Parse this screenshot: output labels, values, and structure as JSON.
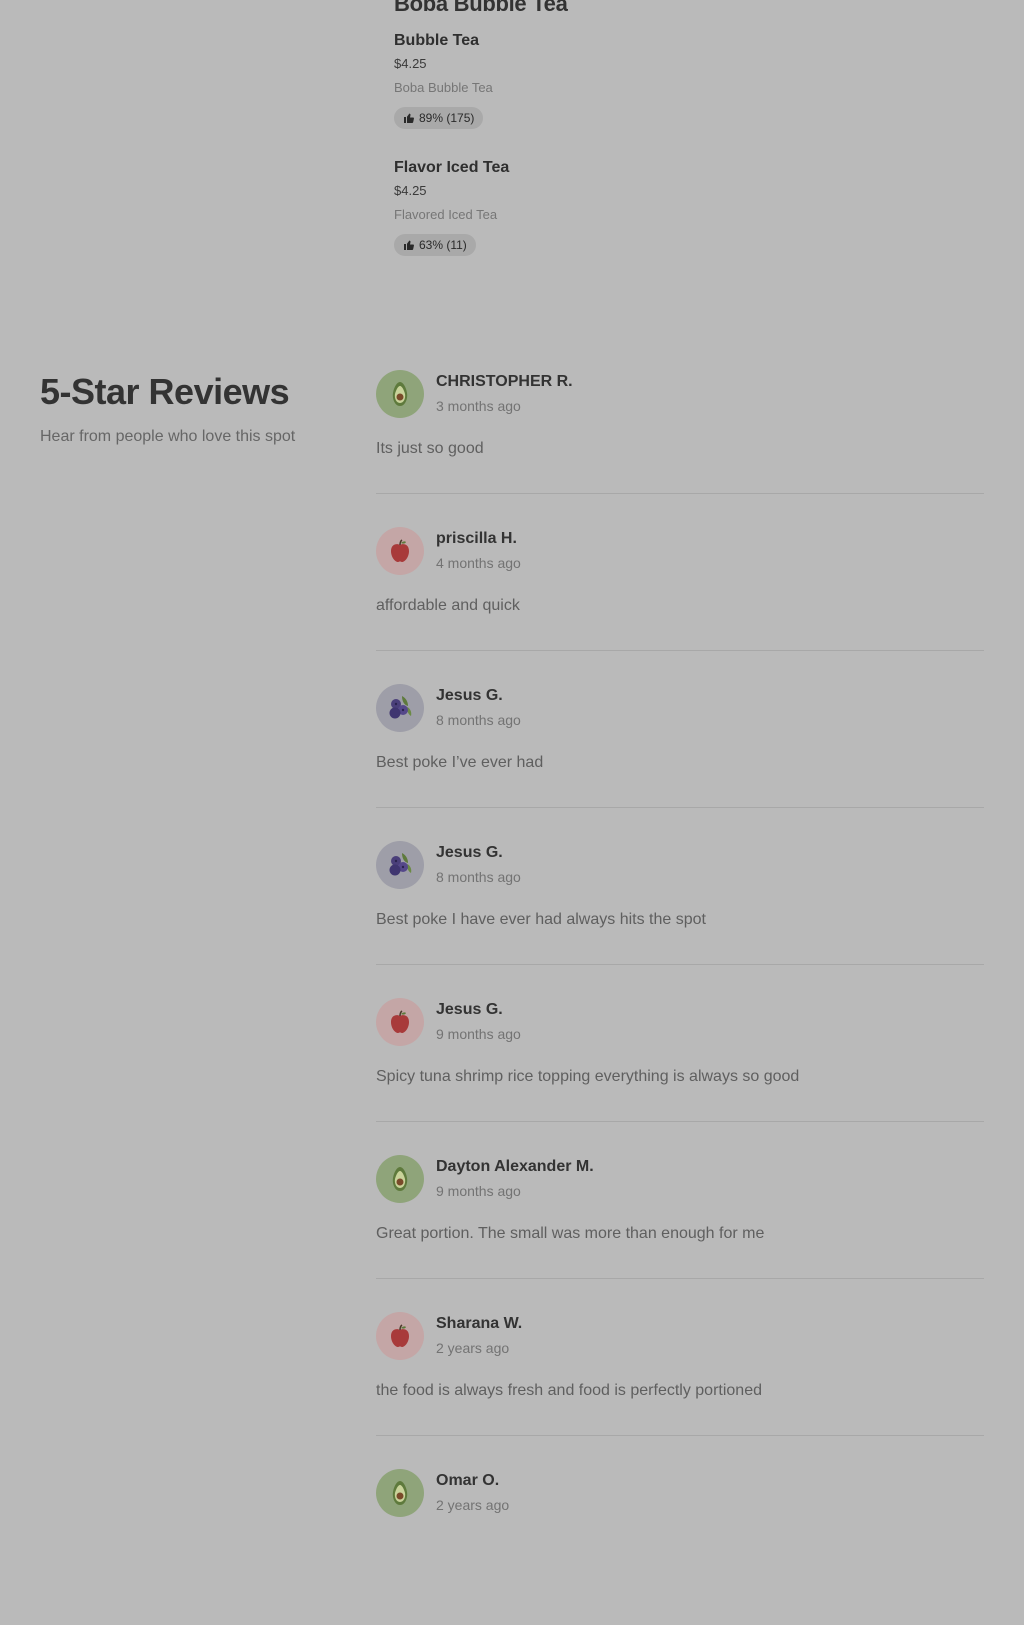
{
  "menu": {
    "section_title": "Boba Bubble Tea",
    "items": [
      {
        "name": "Bubble Tea",
        "price": "$4.25",
        "description": "Boba Bubble Tea",
        "rating": "89% (175)"
      },
      {
        "name": "Flavor Iced Tea",
        "price": "$4.25",
        "description": "Flavored Iced Tea",
        "rating": "63% (11)"
      }
    ]
  },
  "reviews": {
    "title": "5-Star Reviews",
    "subtitle": "Hear from people who love this spot",
    "items": [
      {
        "name": "CHRISTOPHER R.",
        "time": "3 months ago",
        "text": "Its just so good",
        "avatar": "avocado-icon"
      },
      {
        "name": "priscilla H.",
        "time": "4 months ago",
        "text": "affordable and quick",
        "avatar": "apple-icon"
      },
      {
        "name": "Jesus G.",
        "time": "8 months ago",
        "text": "Best poke I’ve ever had",
        "avatar": "blueberries-icon"
      },
      {
        "name": "Jesus G.",
        "time": "8 months ago",
        "text": "Best poke I have ever had always hits the spot",
        "avatar": "blueberries-icon"
      },
      {
        "name": "Jesus G.",
        "time": "9 months ago",
        "text": "Spicy tuna shrimp rice topping everything is always so good",
        "avatar": "apple-icon"
      },
      {
        "name": "Dayton Alexander M.",
        "time": "9 months ago",
        "text": "Great portion. The small was more than enough for me",
        "avatar": "avocado-icon"
      },
      {
        "name": "Sharana W.",
        "time": "2 years ago",
        "text": "the food is always fresh and food is perfectly portioned",
        "avatar": "apple-icon"
      },
      {
        "name": "Omar O.",
        "time": "2 years ago",
        "text": "",
        "avatar": "avocado-icon"
      }
    ]
  },
  "icons": {
    "rating": "thumbs-up-icon"
  }
}
